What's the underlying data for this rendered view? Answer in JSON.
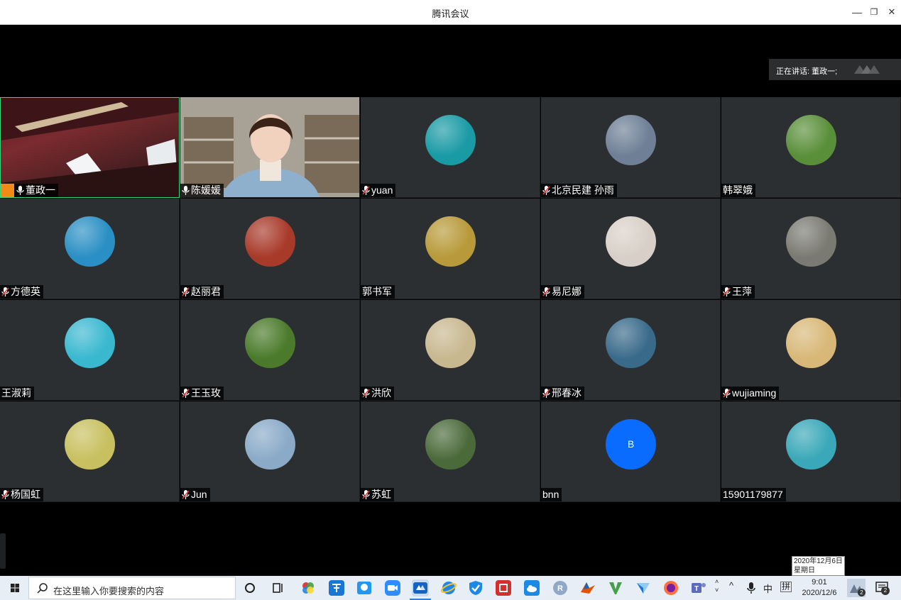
{
  "window": {
    "title": "腾讯会议",
    "minimize": "—",
    "restore": "❐",
    "close": "✕"
  },
  "speaking": {
    "label": "正在讲话: 董政一;"
  },
  "participants": [
    {
      "name": "董政一",
      "kind": "video1",
      "mic": "on",
      "host": true
    },
    {
      "name": "陈媛媛",
      "kind": "video2",
      "mic": "on"
    },
    {
      "name": "yuan",
      "kind": "avatar",
      "bg": "#1a9aa5",
      "mic": "muted"
    },
    {
      "name": "北京民建 孙雨",
      "kind": "avatar",
      "bg": "#6e7f96",
      "mic": "muted"
    },
    {
      "name": "韩翠娥",
      "kind": "avatar",
      "bg": "#5a8f3a",
      "mic": "none"
    },
    {
      "name": "方德英",
      "kind": "avatar",
      "bg": "#2a8fc4",
      "mic": "muted"
    },
    {
      "name": "赵丽君",
      "kind": "avatar",
      "bg": "#a83a2a",
      "mic": "muted"
    },
    {
      "name": "郭书军",
      "kind": "avatar",
      "bg": "#b89a3a",
      "mic": "none"
    },
    {
      "name": "易尼娜",
      "kind": "avatar",
      "bg": "#d8d0c8",
      "mic": "muted"
    },
    {
      "name": "王萍",
      "kind": "avatar",
      "bg": "#7a7a72",
      "mic": "muted"
    },
    {
      "name": "王淑莉",
      "kind": "avatar",
      "bg": "#3ab8d0",
      "mic": "none"
    },
    {
      "name": "王玉玫",
      "kind": "avatar",
      "bg": "#4a7a2a",
      "mic": "muted"
    },
    {
      "name": "洪欣",
      "kind": "avatar",
      "bg": "#c8b890",
      "mic": "muted"
    },
    {
      "name": "邢春冰",
      "kind": "avatar",
      "bg": "#3a6a8a",
      "mic": "muted"
    },
    {
      "name": "wujiaming",
      "kind": "avatar",
      "bg": "#d8b878",
      "mic": "muted"
    },
    {
      "name": "杨国虹",
      "kind": "avatar",
      "bg": "#c8c060",
      "mic": "muted"
    },
    {
      "name": "Jun",
      "kind": "avatar",
      "bg": "#8aaac8",
      "mic": "muted"
    },
    {
      "name": "苏虹",
      "kind": "avatar",
      "bg": "#4a6a3a",
      "mic": "muted"
    },
    {
      "name": "bnn",
      "kind": "letter",
      "letter": "B",
      "mic": "none"
    },
    {
      "name": "15901179877",
      "kind": "avatar",
      "bg": "#3aa8b8",
      "mic": "none"
    }
  ],
  "taskbar": {
    "search_placeholder": "在这里输入你要搜索的内容",
    "tooltip_date": "2020年12月6日",
    "tooltip_weekday": "星期日",
    "time": "9:01",
    "date": "2020/12/6",
    "ime_lang": "中",
    "ime_mode": "拼",
    "notif_count": "2",
    "meet_badge": "2",
    "chevron": "^",
    "circle_r": "R"
  }
}
